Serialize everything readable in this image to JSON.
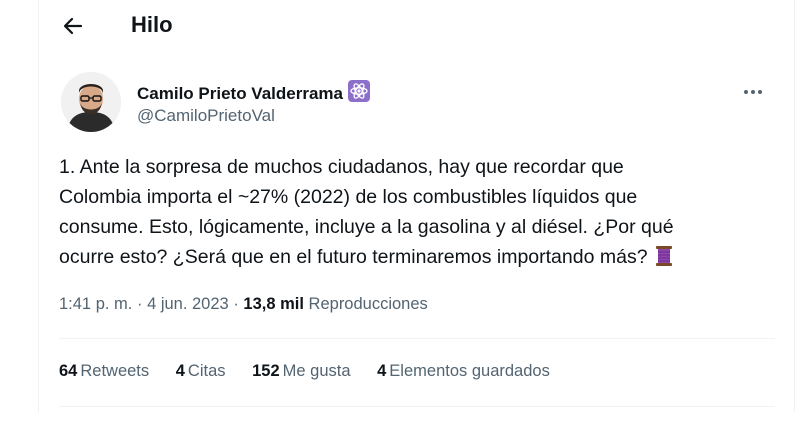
{
  "header": {
    "title": "Hilo",
    "back_icon": "arrow-left-icon"
  },
  "author": {
    "name": "Camilo Prieto Valderrama",
    "badge_icon": "atom-icon",
    "handle": "@CamiloPrietoVal",
    "more_icon": "more-horizontal-icon"
  },
  "tweet": {
    "lines": [
      "1. Ante la sorpresa de muchos ciudadanos, hay que recordar que",
      "Colombia importa el ~27% (2022) de los combustibles líquidos que",
      "consume. Esto, lógicamente, incluye a la gasolina y al diésel. ¿Por qué",
      "ocurre esto? ¿Será que en el futuro terminaremos importando más?"
    ],
    "emoji_icon": "thread-spool-icon"
  },
  "meta": {
    "time": "1:41 p. m.",
    "sep": "·",
    "date": "4 jun. 2023",
    "views_count": "13,8 mil",
    "views_label": "Reproducciones"
  },
  "stats": [
    {
      "count": "64",
      "label": "Retweets"
    },
    {
      "count": "4",
      "label": "Citas"
    },
    {
      "count": "152",
      "label": "Me gusta"
    },
    {
      "count": "4",
      "label": "Elementos guardados"
    }
  ],
  "colors": {
    "text": "#0f1419",
    "secondary": "#536471",
    "border": "#eff3f4",
    "badge": "#8b6fcb"
  }
}
